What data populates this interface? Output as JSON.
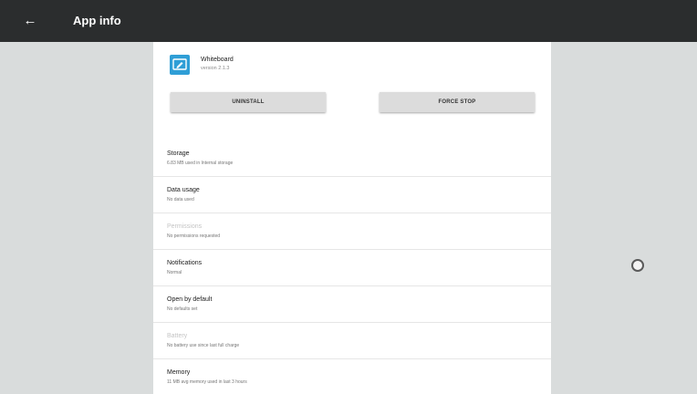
{
  "appbar": {
    "title": "App info",
    "back_icon": "arrow-back-icon"
  },
  "app": {
    "name": "Whiteboard",
    "version": "version 2.1.3",
    "icon": "whiteboard-pen-icon",
    "icon_color": "#2f9ed6"
  },
  "buttons": {
    "uninstall": "UNINSTALL",
    "force_stop": "FORCE STOP"
  },
  "rows": [
    {
      "title": "Storage",
      "subtitle": "6.83 MB used in Internal storage",
      "enabled": true
    },
    {
      "title": "Data usage",
      "subtitle": "No data used",
      "enabled": true
    },
    {
      "title": "Permissions",
      "subtitle": "No permissions requested",
      "enabled": false
    },
    {
      "title": "Notifications",
      "subtitle": "Normal",
      "enabled": true
    },
    {
      "title": "Open by default",
      "subtitle": "No defaults set",
      "enabled": true
    },
    {
      "title": "Battery",
      "subtitle": "No battery use since last full charge",
      "enabled": false
    },
    {
      "title": "Memory",
      "subtitle": "11 MB avg memory used in last 3 hours",
      "enabled": true
    }
  ],
  "colors": {
    "appbar": "#2b2d2e",
    "background": "#d9dcdc",
    "sheet": "#ffffff"
  }
}
